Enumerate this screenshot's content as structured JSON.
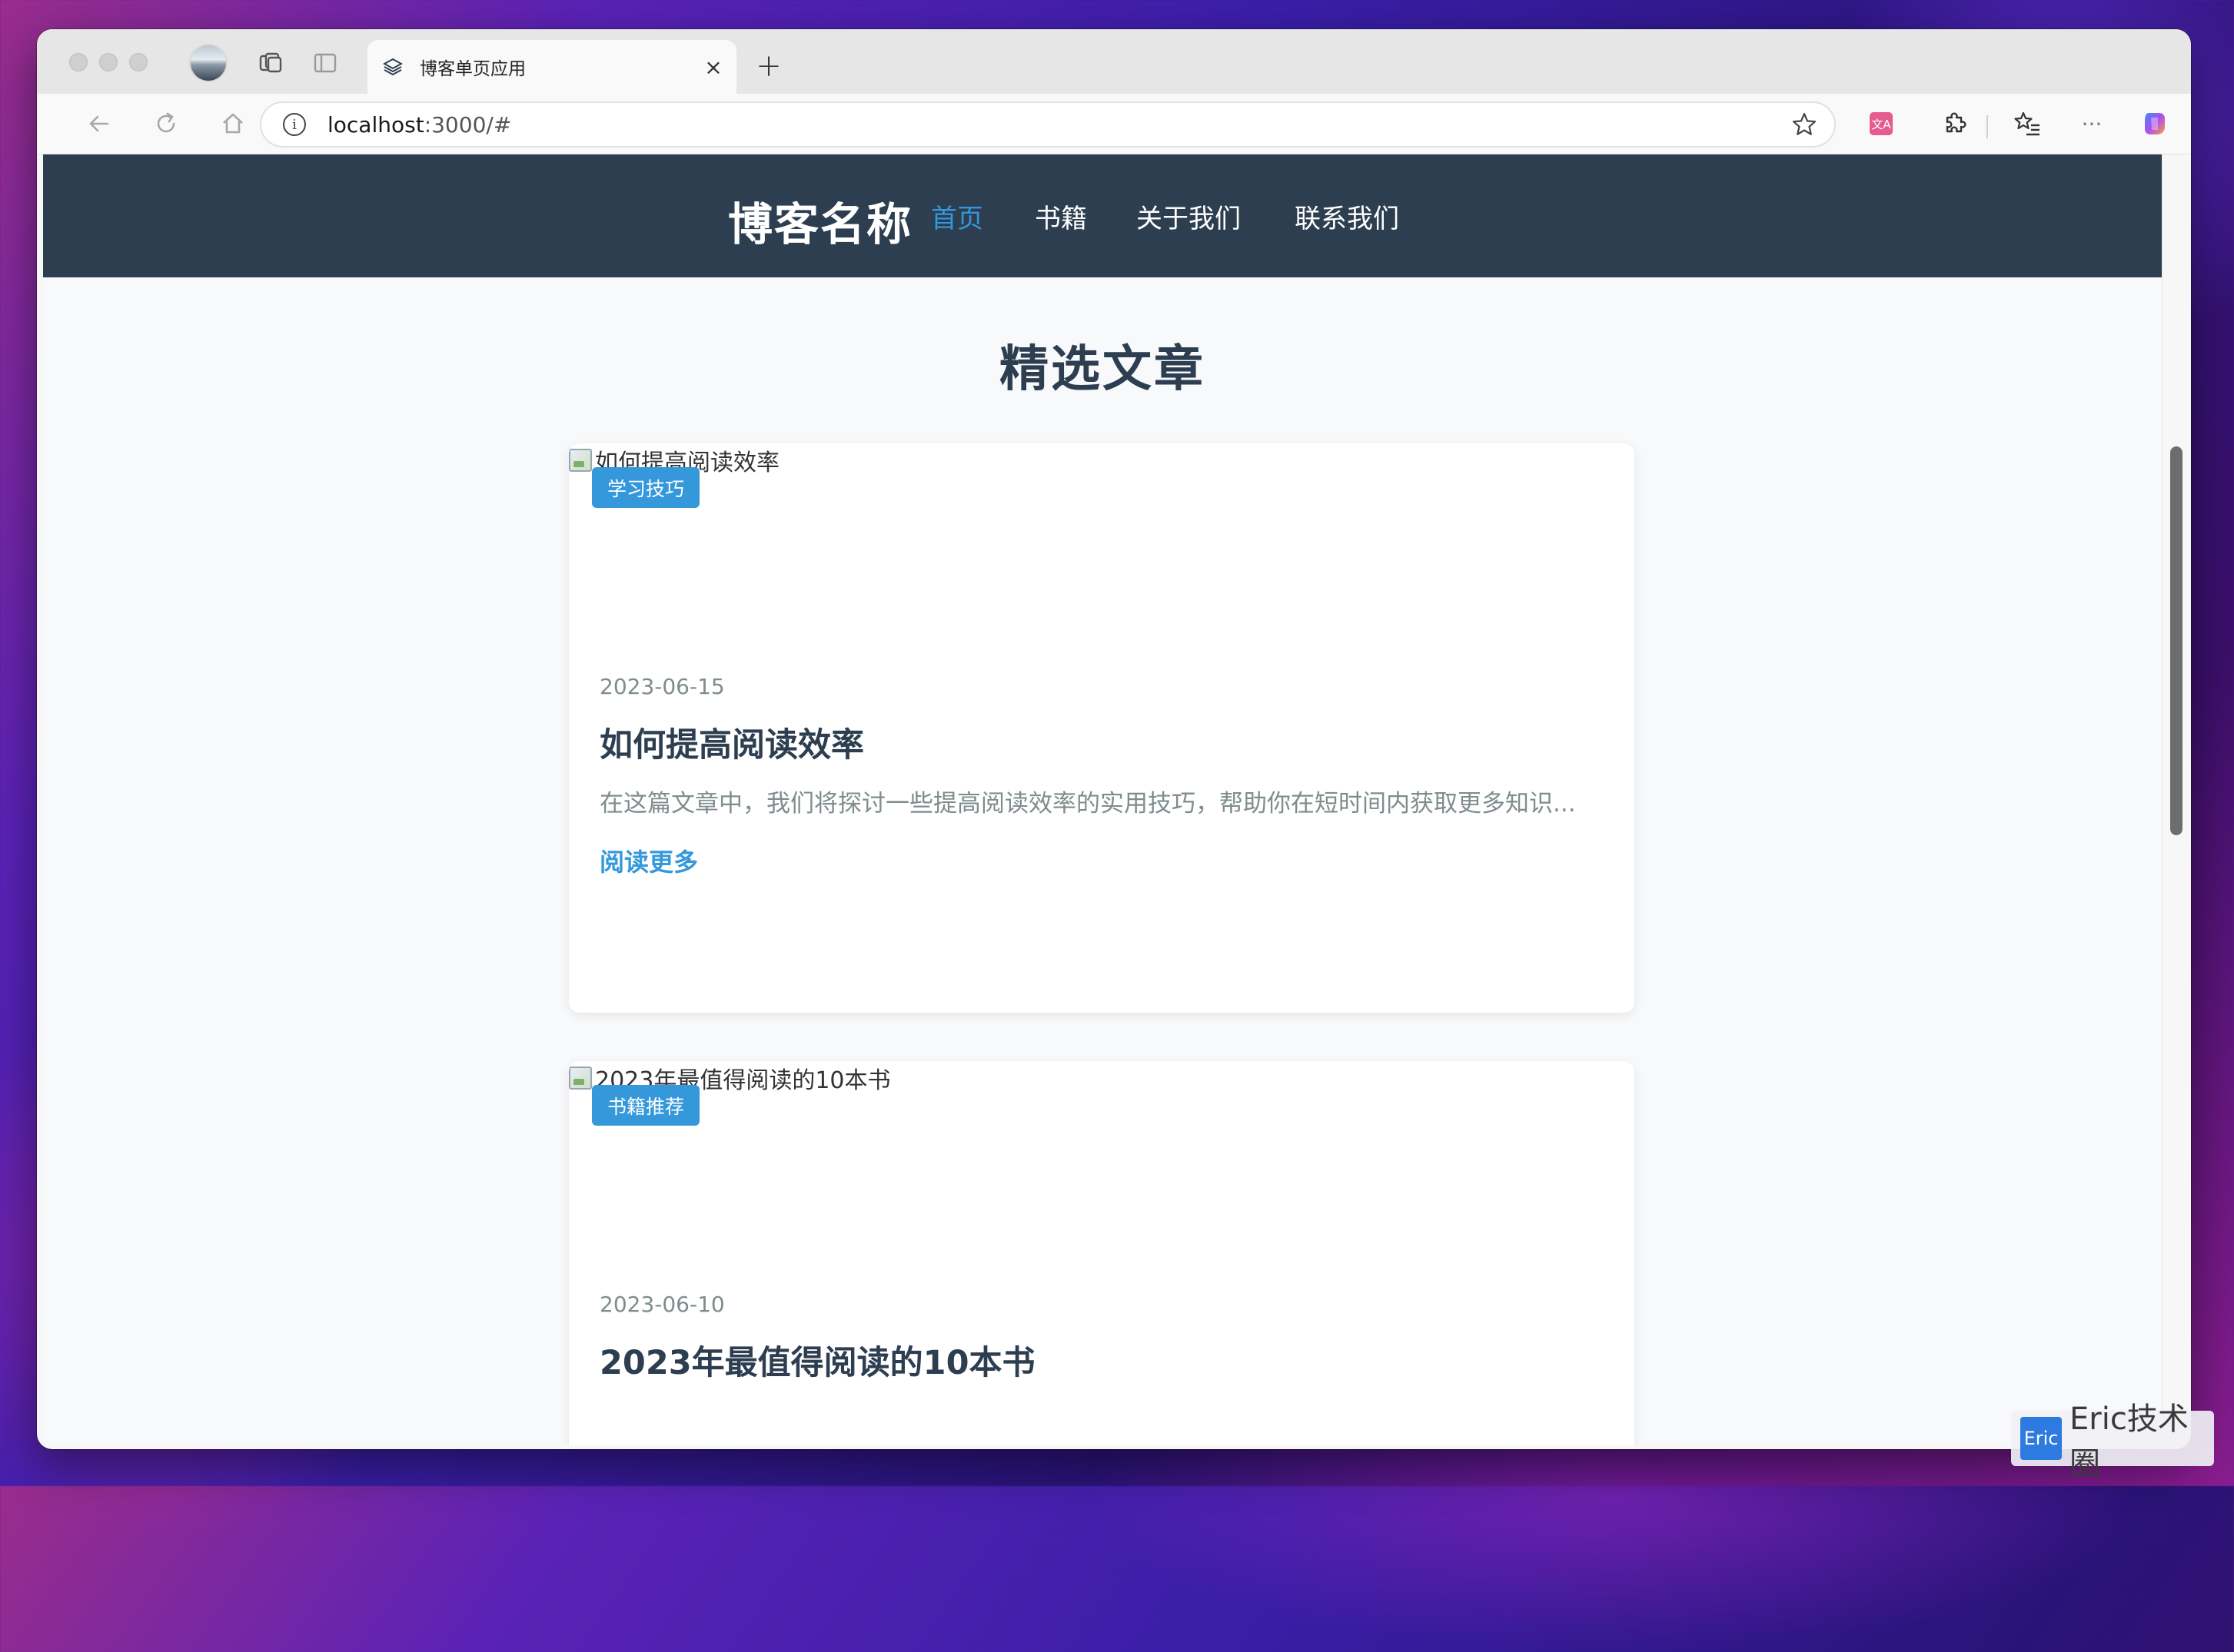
{
  "browser": {
    "tab_title": "博客单页应用",
    "tab_close": "×",
    "new_tab": "+",
    "url_host": "localhost",
    "url_rest": ":3000/#",
    "info_symbol": "i",
    "more_symbol": "···"
  },
  "site": {
    "brand": "博客名称",
    "nav": [
      {
        "label": "首页",
        "active": true
      },
      {
        "label": "书籍",
        "active": false
      },
      {
        "label": "关于我们",
        "active": false
      },
      {
        "label": "联系我们",
        "active": false
      }
    ]
  },
  "section_title": "精选文章",
  "articles": [
    {
      "image_alt": "如何提高阅读效率",
      "category": "学习技巧",
      "date": "2023-06-15",
      "title": "如何提高阅读效率",
      "excerpt": "在这篇文章中，我们将探讨一些提高阅读效率的实用技巧，帮助你在短时间内获取更多知识...",
      "read_more": "阅读更多"
    },
    {
      "image_alt": "2023年最值得阅读的10本书",
      "category": "书籍推荐",
      "date": "2023-06-10",
      "title": "2023年最值得阅读的10本书"
    }
  ],
  "watermark": {
    "logo": "Eric",
    "text": "Eric技术圈"
  },
  "colors": {
    "header_bg": "#2c3e50",
    "accent": "#3498db",
    "muted_text": "#7f8c8d"
  }
}
